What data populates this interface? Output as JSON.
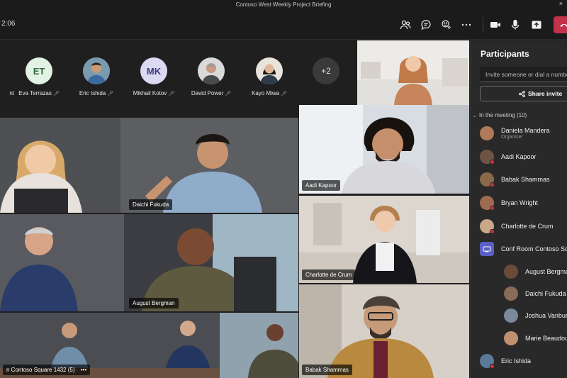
{
  "window": {
    "title": "Contoso West Weekly Project Briefing",
    "close_glyph": "×"
  },
  "meeting": {
    "timer": "2:06"
  },
  "toolbar": {
    "icons": [
      "people-icon",
      "chat-icon",
      "reactions-icon",
      "more-icon",
      "camera-icon",
      "mic-icon",
      "share-screen-icon",
      "leave-call-icon"
    ]
  },
  "strip": {
    "items": [
      {
        "label": "nt",
        "type": "cut"
      },
      {
        "label": "Eva Terrazas",
        "initials": "ET",
        "bg": "#e2f3e6",
        "fg": "#2d6b3c"
      },
      {
        "label": "Eric Ishida",
        "photo": true
      },
      {
        "label": "Mikhail Kotov",
        "initials": "MK",
        "bg": "#dcd9f3",
        "fg": "#3d3a7a"
      },
      {
        "label": "David Power",
        "photo": true
      },
      {
        "label": "Kayo Miwa",
        "photo": true
      }
    ],
    "more_label": "+2"
  },
  "tiles": {
    "daichi": "Daichi Fukuda",
    "aadi": "Aadi Kapoor",
    "august": "August Bergman",
    "charlotte": "Charlotte de Crum",
    "room": "n Contoso Square 1432 (5)",
    "room_more": "•••",
    "babak": "Babak Shammas"
  },
  "participants": {
    "title": "Participants",
    "invite_placeholder": "Invite someone or dial a number",
    "share_invite": "Share invite",
    "section": "In the meeting (10)",
    "organizer_role": "Organizer",
    "people": [
      {
        "name": "Daniela Mandera",
        "role": "Organizer"
      },
      {
        "name": "Aadi Kapoor"
      },
      {
        "name": "Babak Shammas"
      },
      {
        "name": "Bryan Wright"
      },
      {
        "name": "Charlotte de Crum"
      },
      {
        "name": "Conf Room Contoso Square",
        "room": true
      },
      {
        "name": "August Bergman",
        "indent": true
      },
      {
        "name": "Daichi Fukuda",
        "indent": true
      },
      {
        "name": "Joshua Vanburen",
        "indent": true
      },
      {
        "name": "Marie Beaudouin",
        "indent": true
      },
      {
        "name": "Eric Ishida"
      }
    ]
  },
  "colors": {
    "leave": "#c4314b",
    "panel": "#292929",
    "stage": "#1f1f1f",
    "accent": "#5b5fc7"
  }
}
